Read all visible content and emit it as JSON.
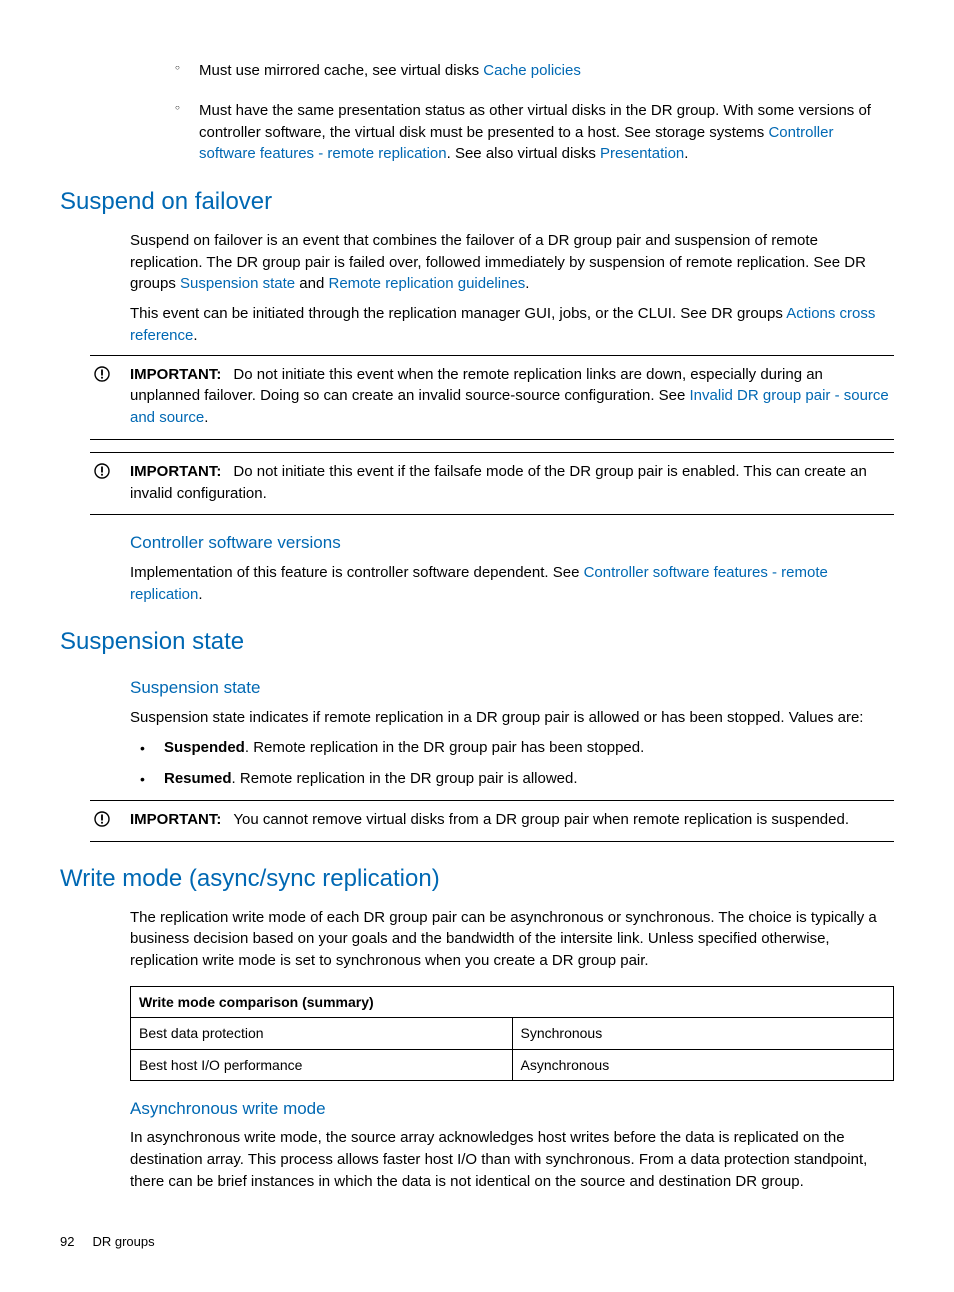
{
  "intro": {
    "bullet1_prefix": "Must use mirrored cache, see virtual disks ",
    "bullet1_link": "Cache policies",
    "bullet2_prefix": "Must have the same presentation status as other virtual disks in the DR group. With some versions of controller software, the virtual disk must be presented to a host. See storage systems ",
    "bullet2_link1": "Controller software features - remote replication",
    "bullet2_mid": ". See also virtual disks ",
    "bullet2_link2": "Presentation",
    "bullet2_suffix": "."
  },
  "suspend": {
    "heading": "Suspend on failover",
    "p1_prefix": "Suspend on failover is an event that combines the failover of a DR group pair and suspension of remote replication. The DR group pair is failed over, followed immediately by suspension of remote replication. See DR groups ",
    "p1_link1": "Suspension state",
    "p1_mid": " and ",
    "p1_link2": "Remote replication guidelines",
    "p1_suffix": ".",
    "p2_prefix": "This event can be initiated through the replication manager GUI, jobs, or the CLUI. See DR groups ",
    "p2_link": "Actions cross reference",
    "p2_suffix": ".",
    "note1_label": "IMPORTANT:",
    "note1_text_prefix": "Do not initiate this event when the remote replication links are down, especially during an unplanned failover. Doing so can create an invalid source-source configuration. See ",
    "note1_link": "Invalid DR group pair - source and source",
    "note1_suffix": ".",
    "note2_label": "IMPORTANT:",
    "note2_text": "Do not initiate this event if the failsafe mode of the DR group pair is enabled. This can create an invalid configuration.",
    "sub_heading": "Controller software versions",
    "sub_text_prefix": "Implementation of this feature is controller software dependent. See ",
    "sub_link": "Controller software features - remote replication",
    "sub_suffix": "."
  },
  "suspension": {
    "heading": "Suspension state",
    "sub_heading": "Suspension state",
    "p1": "Suspension state indicates if remote replication in a DR group pair is allowed or has been stopped. Values are:",
    "li1_bold": "Suspended",
    "li1_text": ". Remote replication in the DR group pair has been stopped.",
    "li2_bold": "Resumed",
    "li2_text": ". Remote replication in the DR group pair is allowed.",
    "note_label": "IMPORTANT:",
    "note_text": "You cannot remove virtual disks from a DR group pair when remote replication is suspended."
  },
  "writemode": {
    "heading": "Write mode (async/sync replication)",
    "p1": "The replication write mode of each DR group pair can be asynchronous or synchronous. The choice is typically a business decision based on your goals and the bandwidth of the intersite link. Unless specified otherwise, replication write mode is set to synchronous when you create a DR group pair.",
    "table_header": "Write mode comparison (summary)",
    "row1_c1": "Best data protection",
    "row1_c2": "Synchronous",
    "row2_c1": "Best host I/O performance",
    "row2_c2": "Asynchronous",
    "sub_heading": "Asynchronous write mode",
    "sub_p1": "In asynchronous write mode, the source array acknowledges host writes before the data is replicated on the destination array. This process allows faster host I/O than with synchronous. From a data protection standpoint, there can be brief instances in which the data is not identical on the source and destination DR group."
  },
  "footer": {
    "page": "92",
    "section": "DR groups"
  }
}
